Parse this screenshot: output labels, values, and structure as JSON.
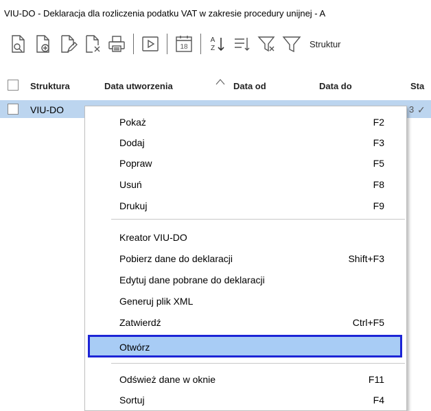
{
  "window": {
    "title": "VIU-DO - Deklaracja dla rozliczenia podatku VAT w zakresie procedury unijnej - A"
  },
  "toolbar": {
    "buttons": [
      "preview-icon",
      "add-document-icon",
      "edit-document-icon",
      "delete-document-icon",
      "print-icon",
      "run-icon",
      "calendar-icon",
      "sort-az-icon",
      "sort-list-icon",
      "filter-clear-icon",
      "filter-icon"
    ],
    "calendar_day": "18",
    "sort_az_top": "A",
    "sort_az_bottom": "Z",
    "structure_label": "Struktur"
  },
  "grid": {
    "columns": [
      "Struktura",
      "Data utworzenia",
      "Data od",
      "Data do",
      "Sta"
    ],
    "rows": [
      {
        "label": "VIU-DO",
        "tail": "3",
        "check": "✓"
      }
    ]
  },
  "context_menu": {
    "items": [
      {
        "label": "Pokaż",
        "shortcut": "F2"
      },
      {
        "label": "Dodaj",
        "shortcut": "F3"
      },
      {
        "label": "Popraw",
        "shortcut": "F5"
      },
      {
        "label": "Usuń",
        "shortcut": "F8"
      },
      {
        "label": "Drukuj",
        "shortcut": "F9"
      },
      {
        "label": "Kreator VIU-DO",
        "shortcut": ""
      },
      {
        "label": "Pobierz dane do deklaracji",
        "shortcut": "Shift+F3"
      },
      {
        "label": "Edytuj dane pobrane do deklaracji",
        "shortcut": ""
      },
      {
        "label": "Generuj plik XML",
        "shortcut": ""
      },
      {
        "label": "Zatwierdź",
        "shortcut": "Ctrl+F5"
      },
      {
        "label": "Otwórz",
        "shortcut": "",
        "highlighted": true
      },
      {
        "label": "Odśwież dane w oknie",
        "shortcut": "F11"
      },
      {
        "label": "Sortuj",
        "shortcut": "F4"
      }
    ]
  },
  "colors": {
    "selected_row": "#bcd5ef",
    "highlight_fill": "#a8ccf5",
    "highlight_border": "#1c24d6"
  }
}
